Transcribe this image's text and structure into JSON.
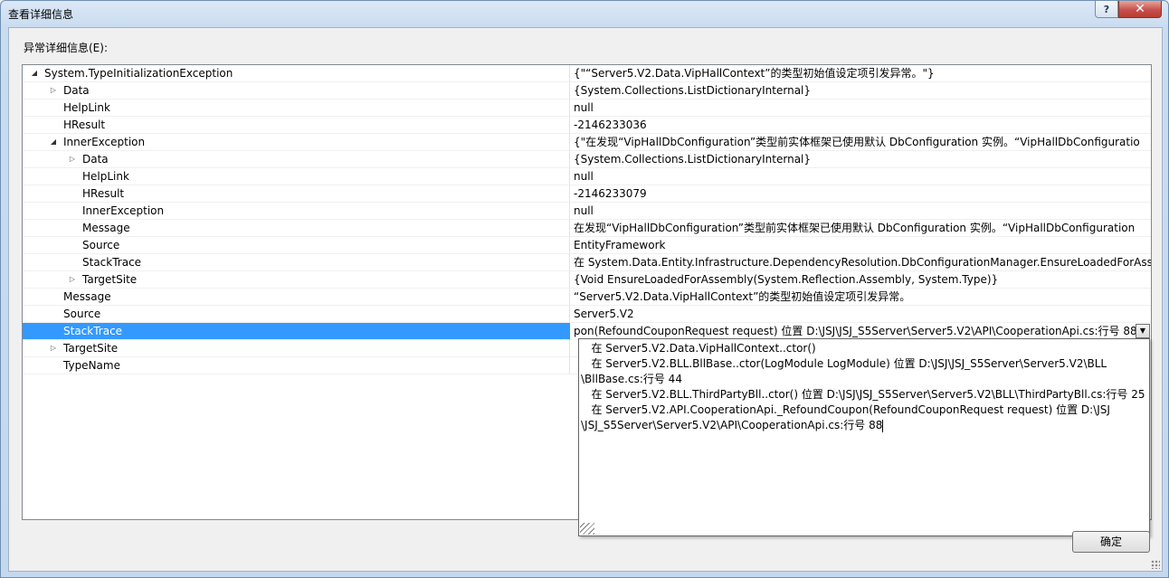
{
  "window": {
    "title": "查看详细信息",
    "help_label": "?",
    "close_label": "✕"
  },
  "section_label": "异常详细信息(E):",
  "rows": [
    {
      "name": "System.TypeInitializationException",
      "value": "{\"“Server5.V2.Data.VipHallContext”的类型初始值设定项引发异常。\"}",
      "expander": "open"
    },
    {
      "name": "Data",
      "value": "{System.Collections.ListDictionaryInternal}",
      "expander": "closed"
    },
    {
      "name": "HelpLink",
      "value": "null",
      "expander": "none"
    },
    {
      "name": "HResult",
      "value": "-2146233036",
      "expander": "none"
    },
    {
      "name": "InnerException",
      "value": "{\"在发现“VipHallDbConfiguration”类型前实体框架已使用默认 DbConfiguration 实例。“VipHallDbConfiguratio",
      "expander": "open"
    },
    {
      "name": "Data",
      "value": "{System.Collections.ListDictionaryInternal}",
      "expander": "closed"
    },
    {
      "name": "HelpLink",
      "value": "null",
      "expander": "none"
    },
    {
      "name": "HResult",
      "value": "-2146233079",
      "expander": "none"
    },
    {
      "name": "InnerException",
      "value": "null",
      "expander": "none"
    },
    {
      "name": "Message",
      "value": "在发现“VipHallDbConfiguration”类型前实体框架已使用默认 DbConfiguration 实例。“VipHallDbConfiguration",
      "expander": "none"
    },
    {
      "name": "Source",
      "value": "EntityFramework",
      "expander": "none"
    },
    {
      "name": "StackTrace",
      "value": "   在 System.Data.Entity.Infrastructure.DependencyResolution.DbConfigurationManager.EnsureLoadedForAss",
      "expander": "none"
    },
    {
      "name": "TargetSite",
      "value": "{Void EnsureLoadedForAssembly(System.Reflection.Assembly, System.Type)}",
      "expander": "closed"
    },
    {
      "name": "Message",
      "value": "“Server5.V2.Data.VipHallContext”的类型初始值设定项引发异常。",
      "expander": "none"
    },
    {
      "name": "Source",
      "value": "Server5.V2",
      "expander": "none"
    },
    {
      "name": "StackTrace",
      "value": "pon(RefoundCouponRequest request) 位置 D:\\JSJ\\JSJ_S5Server\\Server5.V2\\API\\CooperationApi.cs:行号 88",
      "expander": "none",
      "selected": true
    },
    {
      "name": "TargetSite",
      "value": "",
      "expander": "closed"
    },
    {
      "name": "TypeName",
      "value": "",
      "expander": "none"
    }
  ],
  "popup": {
    "text": "   在 Server5.V2.Data.VipHallContext..ctor()\n   在 Server5.V2.BLL.BllBase..ctor(LogModule LogModule) 位置 D:\\JSJ\\JSJ_S5Server\\Server5.V2\\BLL\n\\BllBase.cs:行号 44\n   在 Server5.V2.BLL.ThirdPartyBll..ctor() 位置 D:\\JSJ\\JSJ_S5Server\\Server5.V2\\BLL\\ThirdPartyBll.cs:行号 25\n   在 Server5.V2.API.CooperationApi._RefoundCoupon(RefoundCouponRequest request) 位置 D:\\JSJ\n\\JSJ_S5Server\\Server5.V2\\API\\CooperationApi.cs:行号 88"
  },
  "ok_button": "确定"
}
